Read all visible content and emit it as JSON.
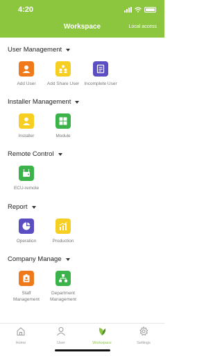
{
  "status": {
    "time": "4:20"
  },
  "nav": {
    "title": "Workspace",
    "right": "Local access"
  },
  "sections": {
    "user": {
      "title": "User Management",
      "items": [
        "Add User",
        "Add Share User",
        "Incomplete User"
      ]
    },
    "installer": {
      "title": "Installer Management",
      "items": [
        "Installer",
        "Module"
      ]
    },
    "remote": {
      "title": "Remote Control",
      "items": [
        "ECU-remote"
      ]
    },
    "report": {
      "title": "Report",
      "items": [
        "Operation",
        "Production"
      ]
    },
    "company": {
      "title": "Company Manage",
      "items": [
        "Staff\nManagement",
        "Department\nManagement"
      ]
    }
  },
  "tabs": [
    "Home",
    "User",
    "Workspace",
    "Settings"
  ],
  "active_tab": "Workspace",
  "colors": {
    "brand": "#8cc63f",
    "orange": "#f07a1a",
    "yellow": "#f7cf22",
    "purple": "#5b4ec2",
    "green": "#3bb34a"
  }
}
